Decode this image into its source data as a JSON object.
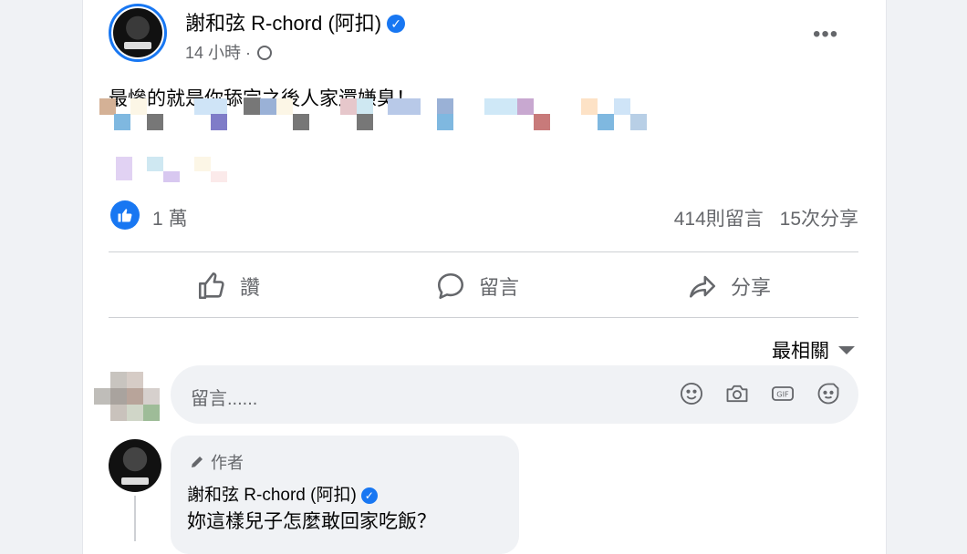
{
  "post": {
    "author": "謝和弦 R-chord (阿扣)",
    "time": "14 小時",
    "separator": "·",
    "text": "最慘的就是你舔完之後人家還嫌臭！"
  },
  "stats": {
    "reactions": "1 萬",
    "comments": "414則留言",
    "shares": "15次分享"
  },
  "actions": {
    "like": "讚",
    "comment": "留言",
    "share": "分享"
  },
  "comments": {
    "sort_label": "最相關",
    "placeholder": "留言......",
    "icons": [
      "emoji-icon",
      "camera-icon",
      "gif-icon",
      "sticker-icon"
    ]
  },
  "reply": {
    "badge": "作者",
    "author": "謝和弦 R-chord (阿扣)",
    "text": "妳這樣兒子怎麼敢回家吃飯？"
  },
  "colors": {
    "accent": "#1877f2",
    "muted": "#65676b"
  }
}
